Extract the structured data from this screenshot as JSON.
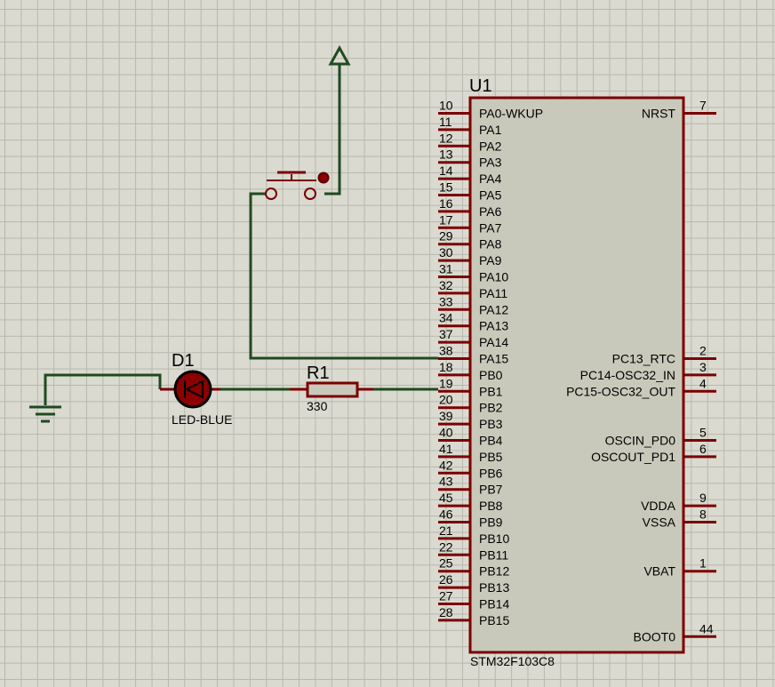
{
  "chip": {
    "ref": "U1",
    "part": "STM32F103C8",
    "left_pins": [
      {
        "num": "10",
        "name": "PA0-WKUP"
      },
      {
        "num": "11",
        "name": "PA1"
      },
      {
        "num": "12",
        "name": "PA2"
      },
      {
        "num": "13",
        "name": "PA3"
      },
      {
        "num": "14",
        "name": "PA4"
      },
      {
        "num": "15",
        "name": "PA5"
      },
      {
        "num": "16",
        "name": "PA6"
      },
      {
        "num": "17",
        "name": "PA7"
      },
      {
        "num": "29",
        "name": "PA8"
      },
      {
        "num": "30",
        "name": "PA9"
      },
      {
        "num": "31",
        "name": "PA10"
      },
      {
        "num": "32",
        "name": "PA11"
      },
      {
        "num": "33",
        "name": "PA12"
      },
      {
        "num": "34",
        "name": "PA13"
      },
      {
        "num": "37",
        "name": "PA14"
      },
      {
        "num": "38",
        "name": "PA15"
      },
      {
        "num": "18",
        "name": "PB0"
      },
      {
        "num": "19",
        "name": "PB1"
      },
      {
        "num": "20",
        "name": "PB2"
      },
      {
        "num": "39",
        "name": "PB3"
      },
      {
        "num": "40",
        "name": "PB4"
      },
      {
        "num": "41",
        "name": "PB5"
      },
      {
        "num": "42",
        "name": "PB6"
      },
      {
        "num": "43",
        "name": "PB7"
      },
      {
        "num": "45",
        "name": "PB8"
      },
      {
        "num": "46",
        "name": "PB9"
      },
      {
        "num": "21",
        "name": "PB10"
      },
      {
        "num": "22",
        "name": "PB11"
      },
      {
        "num": "25",
        "name": "PB12"
      },
      {
        "num": "26",
        "name": "PB13"
      },
      {
        "num": "27",
        "name": "PB14"
      },
      {
        "num": "28",
        "name": "PB15"
      }
    ],
    "right_pins": [
      {
        "num": "7",
        "name": "NRST"
      },
      {
        "num": "2",
        "name": "PC13_RTC"
      },
      {
        "num": "3",
        "name": "PC14-OSC32_IN"
      },
      {
        "num": "4",
        "name": "PC15-OSC32_OUT"
      },
      {
        "num": "5",
        "name": "OSCIN_PD0"
      },
      {
        "num": "6",
        "name": "OSCOUT_PD1"
      },
      {
        "num": "9",
        "name": "VDDA"
      },
      {
        "num": "8",
        "name": "VSSA"
      },
      {
        "num": "1",
        "name": "VBAT"
      },
      {
        "num": "44",
        "name": "BOOT0"
      }
    ]
  },
  "led": {
    "ref": "D1",
    "value": "LED-BLUE"
  },
  "resistor": {
    "ref": "R1",
    "value": "330"
  },
  "colors": {
    "background": "#dadad0",
    "grid": "#b7b7ad",
    "wire": "#1f4a1f",
    "component_outline": "#7a0000",
    "chip_fill": "#c9c9bb",
    "led_fill": "#8b0000"
  }
}
